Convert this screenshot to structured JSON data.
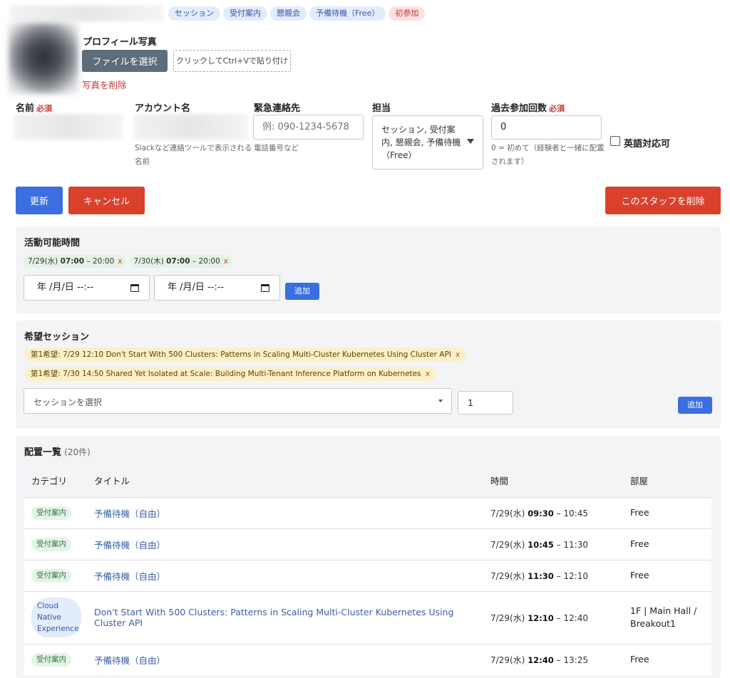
{
  "header": {
    "tags": [
      {
        "label": "セッション",
        "color": "blue"
      },
      {
        "label": "受付案内",
        "color": "blue"
      },
      {
        "label": "懇親会",
        "color": "blue"
      },
      {
        "label": "予備待機（Free）",
        "color": "blue"
      },
      {
        "label": "初参加",
        "color": "red"
      }
    ]
  },
  "photo": {
    "label": "プロフィール写真",
    "choose_file": "ファイルを選択",
    "paste_hint": "クリックしてCtrl+Vで貼り付け",
    "delete": "写真を削除"
  },
  "form": {
    "name": {
      "label": "名前",
      "required": "必須"
    },
    "account": {
      "label": "アカウント名",
      "help": "Slackなど連絡ツールで表示される名前"
    },
    "emergency": {
      "label": "緊急連絡先",
      "placeholder": "例: 090-1234-5678",
      "help": "電話番号など"
    },
    "assignee": {
      "label": "担当",
      "value": "セッション, 受付案内, 懇親会, 予備待機（Free）"
    },
    "past_count": {
      "label": "過去参加回数",
      "required": "必須",
      "value": "0",
      "help": "0 = 初めて（経験者と一緒に配置されます）"
    },
    "english": {
      "label": "英語対応可",
      "checked": false
    }
  },
  "actions": {
    "update": "更新",
    "cancel": "キャンセル",
    "delete_staff": "このスタッフを削除"
  },
  "availability": {
    "title": "活動可能時間",
    "slots": [
      {
        "date": "7/29(水)",
        "start": "07:00",
        "end": "20:00"
      },
      {
        "date": "7/30(木)",
        "start": "07:00",
        "end": "20:00"
      }
    ],
    "input_placeholder": "年 /月/日 --:--",
    "add": "追加",
    "remove": "x",
    "sep": "–"
  },
  "session_pref": {
    "title": "希望セッション",
    "items": [
      "第1希望: 7/29 12:10 Don't Start With 500 Clusters: Patterns in Scaling Multi-Cluster Kubernetes Using Cluster API",
      "第1希望: 7/30 14:50 Shared Yet Isolated at Scale: Building Multi-Tenant Inference Platform on Kubernetes"
    ],
    "remove": "x",
    "select_placeholder": "セッションを選択",
    "priority_value": "1",
    "add": "追加"
  },
  "allocation": {
    "title": "配置一覧",
    "count": "(20件)",
    "columns": {
      "category": "カテゴリ",
      "title": "タイトル",
      "time": "時間",
      "room": "部屋"
    },
    "rows": [
      {
        "category": "受付案内",
        "cat_style": "green",
        "title": "予備待機（自由）",
        "date": "7/29(水)",
        "start": "09:30",
        "end": "10:45",
        "room": "Free"
      },
      {
        "category": "受付案内",
        "cat_style": "green",
        "title": "予備待機（自由）",
        "date": "7/29(水)",
        "start": "10:45",
        "end": "11:30",
        "room": "Free"
      },
      {
        "category": "受付案内",
        "cat_style": "green",
        "title": "予備待機（自由）",
        "date": "7/29(水)",
        "start": "11:30",
        "end": "12:10",
        "room": "Free"
      },
      {
        "category": "Cloud Native Experience",
        "cat_style": "blue",
        "title": "Don't Start With 500 Clusters: Patterns in Scaling Multi-Cluster Kubernetes Using Cluster API",
        "date": "7/29(水)",
        "start": "12:10",
        "end": "12:40",
        "room": "1F | Main Hall / Breakout1"
      },
      {
        "category": "受付案内",
        "cat_style": "green",
        "title": "予備待機（自由）",
        "date": "7/29(水)",
        "start": "12:40",
        "end": "13:25",
        "room": "Free"
      }
    ]
  }
}
